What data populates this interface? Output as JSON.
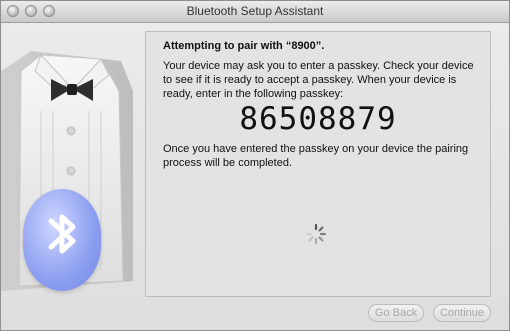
{
  "window": {
    "title": "Bluetooth Setup Assistant"
  },
  "main": {
    "heading": "Attempting to pair with “8900”.",
    "instructions": "Your device may ask you to enter a passkey. Check your device to see if it is ready to accept a passkey. When your device is ready, enter in the following passkey:",
    "passkey": "86508879",
    "followup": "Once you have entered the passkey on your device the pairing process will be completed."
  },
  "buttons": {
    "go_back": "Go Back",
    "continue": "Continue"
  },
  "icons": {
    "bluetooth": "bluetooth-icon",
    "spinner": "progress-spinner-icon"
  },
  "colors": {
    "bluetooth_badge": "#8c9ff0",
    "disabled_text": "#a8a8a8"
  }
}
